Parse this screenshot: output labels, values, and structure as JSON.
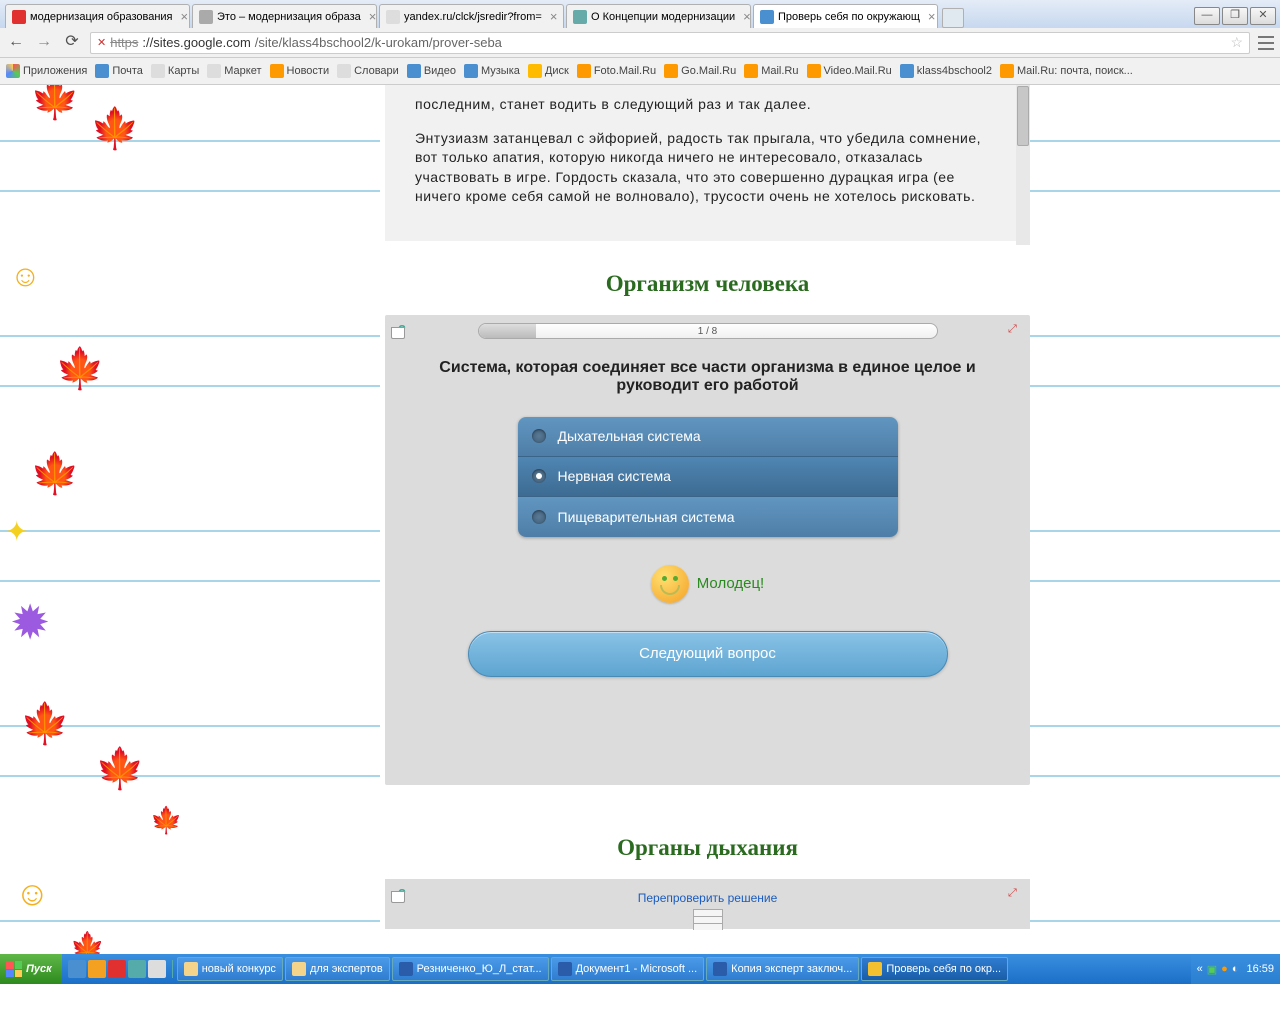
{
  "tabs": [
    {
      "label": "модернизация образования",
      "color": "#e03030"
    },
    {
      "label": "Это – модернизация образа",
      "color": "#aaa"
    },
    {
      "label": "yandex.ru/clck/jsredir?from=",
      "color": "#ddd"
    },
    {
      "label": "О Концепции модернизации",
      "color": "#6aa"
    },
    {
      "label": "Проверь себя по окружающ",
      "color": "#4a90d0",
      "active": true
    }
  ],
  "winbtns": {
    "min": "—",
    "max": "❐",
    "close": "✕"
  },
  "nav": {
    "back": "←",
    "fwd": "→",
    "reload": "⟳"
  },
  "url": {
    "strike": "https",
    "host": "://sites.google.com",
    "path": "/site/klass4bschool2/k-urokam/prover-seba"
  },
  "bookmarks": [
    {
      "label": "Приложения",
      "color": "#f55"
    },
    {
      "label": "Почта",
      "color": "#4a90d0"
    },
    {
      "label": "Карты",
      "color": "#ddd"
    },
    {
      "label": "Маркет",
      "color": "#ddd"
    },
    {
      "label": "Новости",
      "color": "#f90"
    },
    {
      "label": "Словари",
      "color": "#ddd"
    },
    {
      "label": "Видео",
      "color": "#4a90d0"
    },
    {
      "label": "Музыка",
      "color": "#4a90d0"
    },
    {
      "label": "Диск",
      "color": "#fb0"
    },
    {
      "label": "Foto.Mail.Ru",
      "color": "#f90"
    },
    {
      "label": "Go.Mail.Ru",
      "color": "#f90"
    },
    {
      "label": "Mail.Ru",
      "color": "#f90"
    },
    {
      "label": "Video.Mail.Ru",
      "color": "#f90"
    },
    {
      "label": "klass4bschool2",
      "color": "#4a90d0"
    },
    {
      "label": "Mail.Ru: почта, поиск...",
      "color": "#f90"
    }
  ],
  "text": {
    "p1": "последним, станет водить в следующий раз и так далее.",
    "p2": "Энтузиазм затанцевал с эйфорией, радость так прыгала, что убедила сомнение, вот только апатия, которую никогда ничего не интересовало, отказалась участвовать в игре. Гордость сказала, что это совершенно дурацкая игра (ее ничего кроме себя самой не волновало), трусости очень не хотелось рисковать."
  },
  "section1": "Организм человека",
  "quiz": {
    "progress": "1 / 8",
    "question": "Система, которая соединяет все части организма в единое целое и руководит его работой",
    "opts": [
      "Дыхательная система",
      "Нервная система",
      "Пищеварительная система"
    ],
    "feedback": "Молодец!",
    "next": "Следующий вопрос"
  },
  "section2": "Органы дыхания",
  "recheck": "Перепроверить решение",
  "taskbar": {
    "start": "Пуск",
    "tasks": [
      {
        "label": "новый конкурс",
        "color": "#f3d48a"
      },
      {
        "label": "для экспертов",
        "color": "#f3d48a"
      },
      {
        "label": "Резниченко_Ю_Л_стат...",
        "color": "#2a5caa"
      },
      {
        "label": "Документ1 - Microsoft ...",
        "color": "#2a5caa"
      },
      {
        "label": "Копия эксперт заключ...",
        "color": "#2a5caa"
      },
      {
        "label": "Проверь себя по окр...",
        "color": "#f3c030",
        "active": true
      }
    ],
    "clock": "16:59"
  }
}
